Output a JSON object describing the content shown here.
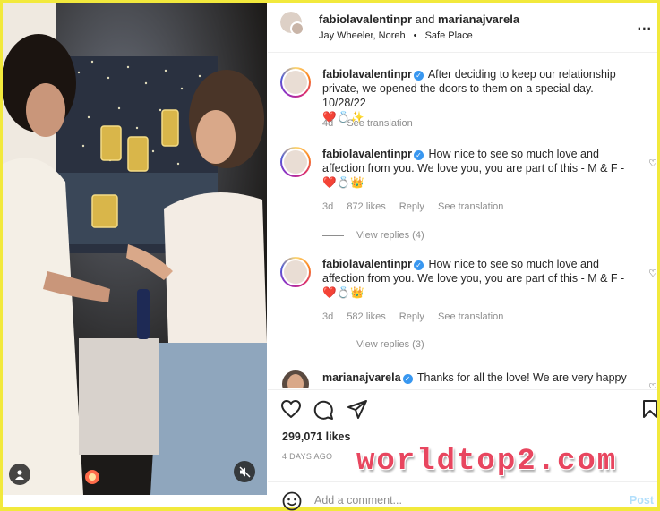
{
  "colors": {
    "frame": "#f2e93c",
    "verified": "#3897f0",
    "muted": "#8e8e8e",
    "post_disabled": "#b2dffc",
    "watermark": "#e8465f"
  },
  "header": {
    "user1": "fabiolavalentinpr",
    "joiner": "and",
    "user2": "marianajvarela",
    "audio": "Jay Wheeler, Noreh",
    "dot": "•",
    "song": "Safe Place",
    "more_label": "..."
  },
  "comments": [
    {
      "user": "fabiolavalentinpr",
      "text": "After deciding to keep our relationship private, we opened the doors to them on a special day. 10/28/22",
      "emoji": "❤️💍✨",
      "time": "4d",
      "actions": [
        "See translation"
      ]
    },
    {
      "user": "fabiolavalentinpr",
      "text": "How nice to see so much love and affection from you. We love you, you are part of this - M & F -",
      "emoji": "❤️💍👑",
      "time": "3d",
      "likes": "872 likes",
      "actions": [
        "Reply",
        "See translation"
      ],
      "view_replies": "View replies (4)"
    },
    {
      "user": "fabiolavalentinpr",
      "text": "How nice to see so much love and affection from you. We love you, you are part of this - M & F -",
      "emoji": "❤️💍👑",
      "time": "3d",
      "likes": "582 likes",
      "actions": [
        "Reply",
        "See translation"
      ],
      "view_replies": "View replies (3)"
    },
    {
      "user": "marianajvarela",
      "text": "Thanks for all the love! We are very happy"
    }
  ],
  "post": {
    "likes": "299,071 likes",
    "date": "4 DAYS AGO",
    "add_comment_placeholder": "Add a comment...",
    "post_label": "Post"
  },
  "icons": [
    "heart-icon",
    "comment-icon",
    "share-icon",
    "bookmark-icon",
    "emoji-icon",
    "user-tag-icon",
    "mute-icon",
    "verified-icon"
  ],
  "watermark": "worldtop2.com"
}
